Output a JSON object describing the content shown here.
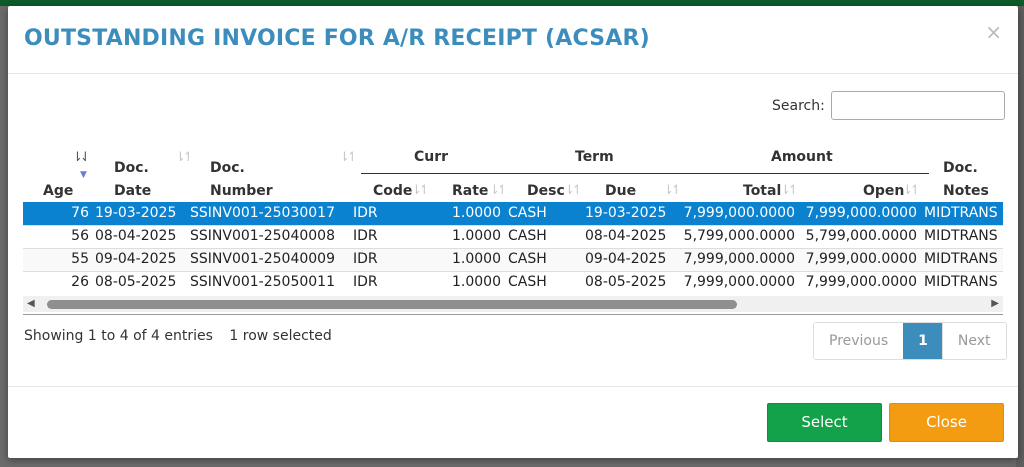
{
  "modal": {
    "title": "OUTSTANDING INVOICE FOR A/R RECEIPT (ACSAR)",
    "close_glyph": "×"
  },
  "search": {
    "label": "Search:",
    "value": "",
    "placeholder": ""
  },
  "table": {
    "group_headers": {
      "curr": "Curr",
      "term": "Term",
      "amount": "Amount"
    },
    "headers": {
      "age": "Age",
      "doc_date_1": "Doc.",
      "doc_date_2": "Date",
      "doc_number_1": "Doc.",
      "doc_number_2": "Number",
      "curr_code": "Code",
      "curr_rate": "Rate",
      "term_desc": "Desc",
      "term_due": "Due",
      "amount_total": "Total",
      "amount_open": "Open",
      "doc_notes_1": "Doc.",
      "doc_notes_2": "Notes"
    },
    "rows": [
      {
        "age": "76",
        "doc_date": "19-03-2025",
        "doc_number": "SSINV001-25030017",
        "curr_code": "IDR",
        "rate": "1.0000",
        "desc": "CASH",
        "due": "19-03-2025",
        "total": "7,999,000.0000",
        "open": "7,999,000.0000",
        "notes": "MIDTRANS"
      },
      {
        "age": "56",
        "doc_date": "08-04-2025",
        "doc_number": "SSINV001-25040008",
        "curr_code": "IDR",
        "rate": "1.0000",
        "desc": "CASH",
        "due": "08-04-2025",
        "total": "5,799,000.0000",
        "open": "5,799,000.0000",
        "notes": "MIDTRANS"
      },
      {
        "age": "55",
        "doc_date": "09-04-2025",
        "doc_number": "SSINV001-25040009",
        "curr_code": "IDR",
        "rate": "1.0000",
        "desc": "CASH",
        "due": "09-04-2025",
        "total": "7,999,000.0000",
        "open": "7,999,000.0000",
        "notes": "MIDTRANS"
      },
      {
        "age": "26",
        "doc_date": "08-05-2025",
        "doc_number": "SSINV001-25050011",
        "curr_code": "IDR",
        "rate": "1.0000",
        "desc": "CASH",
        "due": "08-05-2025",
        "total": "7,999,000.0000",
        "open": "7,999,000.0000",
        "notes": "MIDTRANS"
      }
    ]
  },
  "info": {
    "showing": "Showing 1 to 4 of 4 entries",
    "selected": "1 row selected"
  },
  "pagination": {
    "previous": "Previous",
    "current": "1",
    "next": "Next"
  },
  "buttons": {
    "select": "Select",
    "close": "Close"
  },
  "colors": {
    "title": "#3c8dbc",
    "selected_row": "#0b82d0",
    "select_button": "#13a24a",
    "close_button": "#f39c12",
    "pager_active": "#3c8dbc"
  }
}
